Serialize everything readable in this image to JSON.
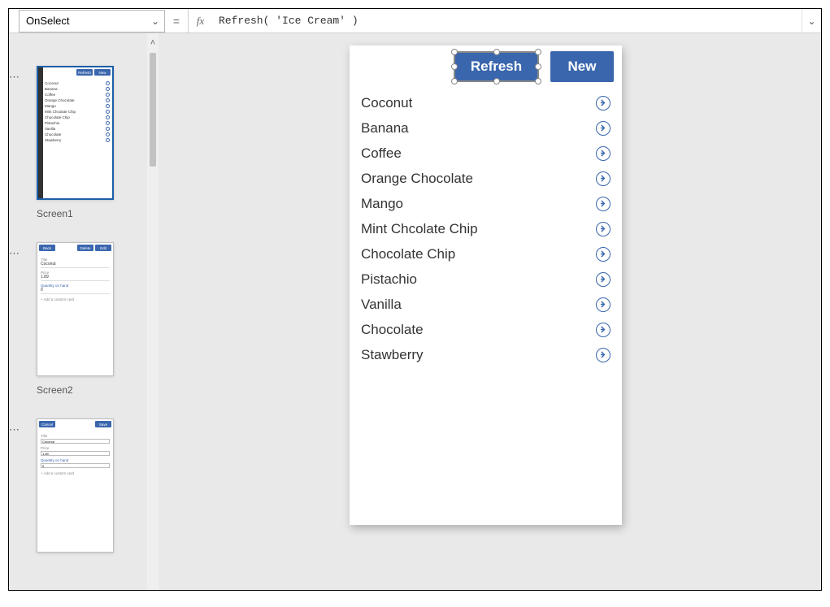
{
  "formula_bar": {
    "property": "OnSelect",
    "formula": "Refresh( 'Ice Cream' )"
  },
  "thumbnails": {
    "screen1": {
      "label": "Screen1",
      "btn_refresh": "Refresh",
      "btn_new": "New",
      "items": [
        "Coconut",
        "Banana",
        "Coffee",
        "Orange Chocolate",
        "Mango",
        "Mint Chcolate Chip",
        "Chocolate Chip",
        "Pistachio",
        "Vanilla",
        "Chocolate",
        "Stawberry"
      ]
    },
    "screen2": {
      "label": "Screen2",
      "btn_back": "Back",
      "btn_delete": "Delete",
      "btn_edit": "Edit",
      "title_lbl": "Title",
      "title_val": "Coconut",
      "price_lbl": "Price",
      "price_val": "1.89",
      "qty_lbl": "Quantity on hand",
      "qty_val": "0",
      "add": "+  Add a custom card"
    },
    "screen3": {
      "btn_cancel": "Cancel",
      "btn_save": "Save",
      "title_lbl": "Title",
      "title_val": "Coconut",
      "price_lbl": "Price",
      "price_val": "1.89",
      "qty_lbl": "Quantity on hand",
      "qty_val": "0",
      "add": "+  Add a custom card"
    }
  },
  "app": {
    "refresh_label": "Refresh",
    "new_label": "New",
    "items": [
      "Coconut",
      "Banana",
      "Coffee",
      "Orange Chocolate",
      "Mango",
      "Mint Chcolate Chip",
      "Chocolate Chip",
      "Pistachio",
      "Vanilla",
      "Chocolate",
      "Stawberry"
    ]
  },
  "colors": {
    "primary": "#3a66ad"
  }
}
